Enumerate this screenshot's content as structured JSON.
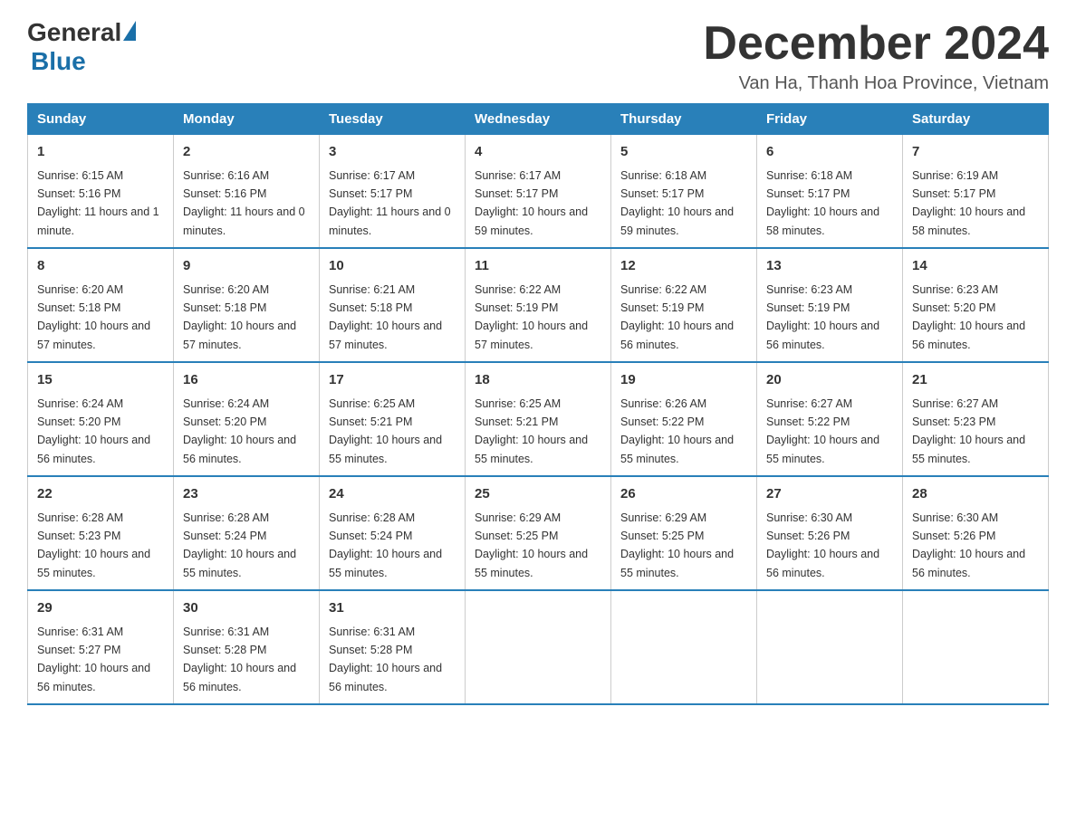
{
  "header": {
    "logo_general": "General",
    "logo_blue": "Blue",
    "month_title": "December 2024",
    "subtitle": "Van Ha, Thanh Hoa Province, Vietnam"
  },
  "weekdays": [
    "Sunday",
    "Monday",
    "Tuesday",
    "Wednesday",
    "Thursday",
    "Friday",
    "Saturday"
  ],
  "weeks": [
    [
      {
        "day": "1",
        "sunrise": "6:15 AM",
        "sunset": "5:16 PM",
        "daylight": "11 hours and 1 minute."
      },
      {
        "day": "2",
        "sunrise": "6:16 AM",
        "sunset": "5:16 PM",
        "daylight": "11 hours and 0 minutes."
      },
      {
        "day": "3",
        "sunrise": "6:17 AM",
        "sunset": "5:17 PM",
        "daylight": "11 hours and 0 minutes."
      },
      {
        "day": "4",
        "sunrise": "6:17 AM",
        "sunset": "5:17 PM",
        "daylight": "10 hours and 59 minutes."
      },
      {
        "day": "5",
        "sunrise": "6:18 AM",
        "sunset": "5:17 PM",
        "daylight": "10 hours and 59 minutes."
      },
      {
        "day": "6",
        "sunrise": "6:18 AM",
        "sunset": "5:17 PM",
        "daylight": "10 hours and 58 minutes."
      },
      {
        "day": "7",
        "sunrise": "6:19 AM",
        "sunset": "5:17 PM",
        "daylight": "10 hours and 58 minutes."
      }
    ],
    [
      {
        "day": "8",
        "sunrise": "6:20 AM",
        "sunset": "5:18 PM",
        "daylight": "10 hours and 57 minutes."
      },
      {
        "day": "9",
        "sunrise": "6:20 AM",
        "sunset": "5:18 PM",
        "daylight": "10 hours and 57 minutes."
      },
      {
        "day": "10",
        "sunrise": "6:21 AM",
        "sunset": "5:18 PM",
        "daylight": "10 hours and 57 minutes."
      },
      {
        "day": "11",
        "sunrise": "6:22 AM",
        "sunset": "5:19 PM",
        "daylight": "10 hours and 57 minutes."
      },
      {
        "day": "12",
        "sunrise": "6:22 AM",
        "sunset": "5:19 PM",
        "daylight": "10 hours and 56 minutes."
      },
      {
        "day": "13",
        "sunrise": "6:23 AM",
        "sunset": "5:19 PM",
        "daylight": "10 hours and 56 minutes."
      },
      {
        "day": "14",
        "sunrise": "6:23 AM",
        "sunset": "5:20 PM",
        "daylight": "10 hours and 56 minutes."
      }
    ],
    [
      {
        "day": "15",
        "sunrise": "6:24 AM",
        "sunset": "5:20 PM",
        "daylight": "10 hours and 56 minutes."
      },
      {
        "day": "16",
        "sunrise": "6:24 AM",
        "sunset": "5:20 PM",
        "daylight": "10 hours and 56 minutes."
      },
      {
        "day": "17",
        "sunrise": "6:25 AM",
        "sunset": "5:21 PM",
        "daylight": "10 hours and 55 minutes."
      },
      {
        "day": "18",
        "sunrise": "6:25 AM",
        "sunset": "5:21 PM",
        "daylight": "10 hours and 55 minutes."
      },
      {
        "day": "19",
        "sunrise": "6:26 AM",
        "sunset": "5:22 PM",
        "daylight": "10 hours and 55 minutes."
      },
      {
        "day": "20",
        "sunrise": "6:27 AM",
        "sunset": "5:22 PM",
        "daylight": "10 hours and 55 minutes."
      },
      {
        "day": "21",
        "sunrise": "6:27 AM",
        "sunset": "5:23 PM",
        "daylight": "10 hours and 55 minutes."
      }
    ],
    [
      {
        "day": "22",
        "sunrise": "6:28 AM",
        "sunset": "5:23 PM",
        "daylight": "10 hours and 55 minutes."
      },
      {
        "day": "23",
        "sunrise": "6:28 AM",
        "sunset": "5:24 PM",
        "daylight": "10 hours and 55 minutes."
      },
      {
        "day": "24",
        "sunrise": "6:28 AM",
        "sunset": "5:24 PM",
        "daylight": "10 hours and 55 minutes."
      },
      {
        "day": "25",
        "sunrise": "6:29 AM",
        "sunset": "5:25 PM",
        "daylight": "10 hours and 55 minutes."
      },
      {
        "day": "26",
        "sunrise": "6:29 AM",
        "sunset": "5:25 PM",
        "daylight": "10 hours and 55 minutes."
      },
      {
        "day": "27",
        "sunrise": "6:30 AM",
        "sunset": "5:26 PM",
        "daylight": "10 hours and 56 minutes."
      },
      {
        "day": "28",
        "sunrise": "6:30 AM",
        "sunset": "5:26 PM",
        "daylight": "10 hours and 56 minutes."
      }
    ],
    [
      {
        "day": "29",
        "sunrise": "6:31 AM",
        "sunset": "5:27 PM",
        "daylight": "10 hours and 56 minutes."
      },
      {
        "day": "30",
        "sunrise": "6:31 AM",
        "sunset": "5:28 PM",
        "daylight": "10 hours and 56 minutes."
      },
      {
        "day": "31",
        "sunrise": "6:31 AM",
        "sunset": "5:28 PM",
        "daylight": "10 hours and 56 minutes."
      },
      null,
      null,
      null,
      null
    ]
  ],
  "labels": {
    "sunrise": "Sunrise:",
    "sunset": "Sunset:",
    "daylight": "Daylight:"
  }
}
